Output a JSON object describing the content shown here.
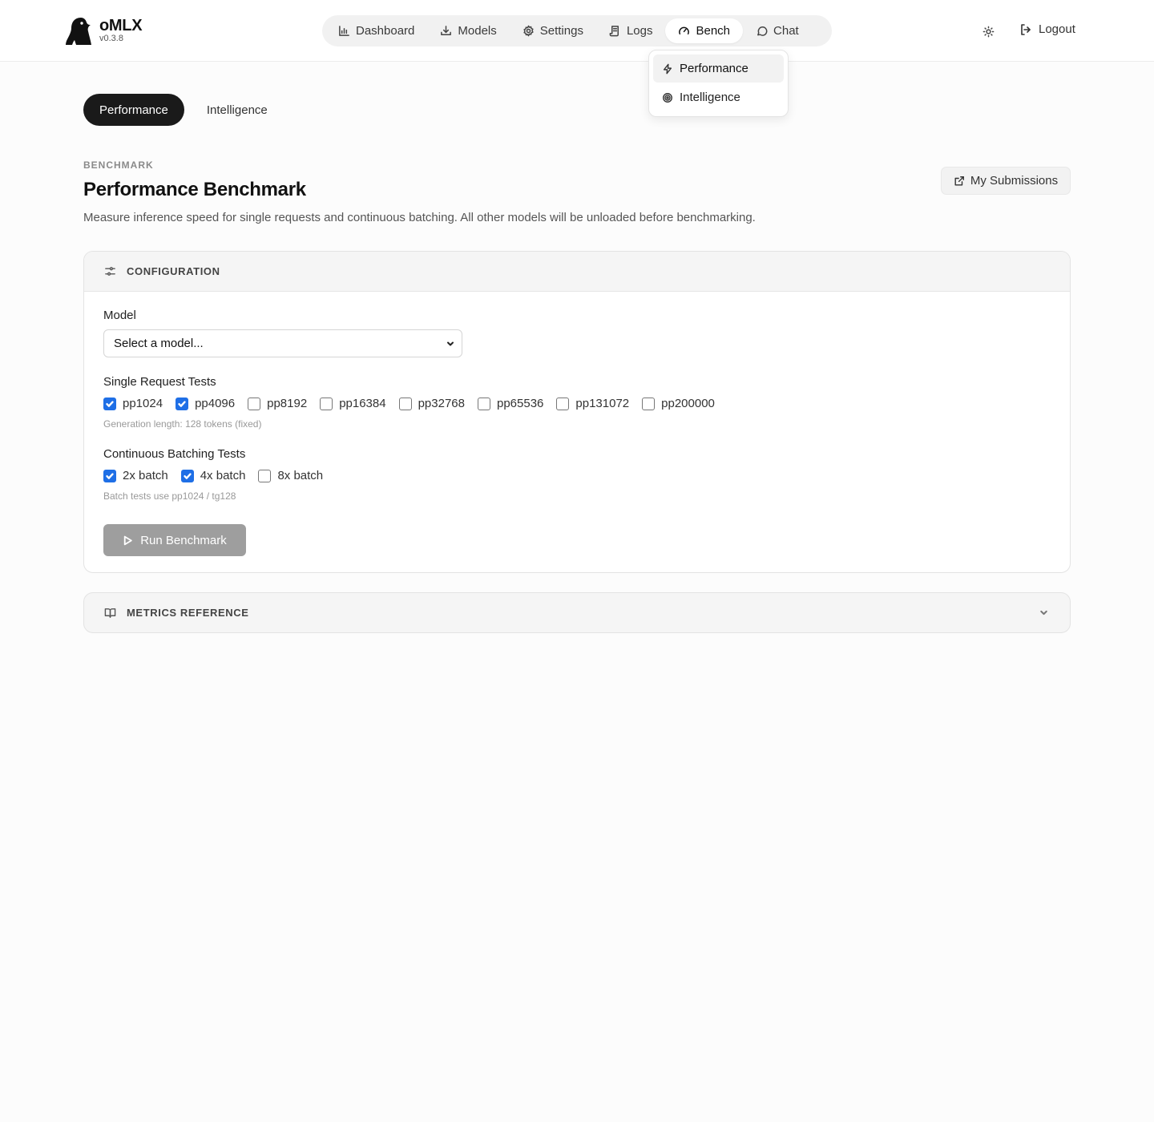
{
  "brand": {
    "name": "oMLX",
    "version": "v0.3.8"
  },
  "nav": {
    "items": [
      {
        "label": "Dashboard",
        "icon": "bar-chart-icon"
      },
      {
        "label": "Models",
        "icon": "download-icon"
      },
      {
        "label": "Settings",
        "icon": "gear-icon"
      },
      {
        "label": "Logs",
        "icon": "scroll-icon"
      },
      {
        "label": "Bench",
        "icon": "gauge-icon",
        "active": true
      },
      {
        "label": "Chat",
        "icon": "chat-bubble-icon"
      }
    ]
  },
  "header_actions": {
    "theme_icon": "sun-icon",
    "logout_label": "Logout"
  },
  "bench_menu": {
    "items": [
      {
        "label": "Performance",
        "icon": "lightning-icon",
        "active": true
      },
      {
        "label": "Intelligence",
        "icon": "target-icon"
      }
    ]
  },
  "subtabs": {
    "performance": "Performance",
    "intelligence": "Intelligence"
  },
  "page": {
    "eyebrow": "BENCHMARK",
    "title": "Performance Benchmark",
    "description": "Measure inference speed for single requests and continuous batching. All other models will be unloaded before benchmarking.",
    "submissions_label": "My Submissions"
  },
  "config": {
    "title": "CONFIGURATION",
    "model_label": "Model",
    "model_value": "Select a model...",
    "single_label": "Single Request Tests",
    "single_tests": [
      {
        "label": "pp1024",
        "checked": true
      },
      {
        "label": "pp4096",
        "checked": true
      },
      {
        "label": "pp8192",
        "checked": false
      },
      {
        "label": "pp16384",
        "checked": false
      },
      {
        "label": "pp32768",
        "checked": false
      },
      {
        "label": "pp65536",
        "checked": false
      },
      {
        "label": "pp131072",
        "checked": false
      },
      {
        "label": "pp200000",
        "checked": false
      }
    ],
    "single_hint": "Generation length: 128 tokens (fixed)",
    "batch_label": "Continuous Batching Tests",
    "batch_tests": [
      {
        "label": "2x batch",
        "checked": true
      },
      {
        "label": "4x batch",
        "checked": true
      },
      {
        "label": "8x batch",
        "checked": false
      }
    ],
    "batch_hint": "Batch tests use pp1024 / tg128",
    "run_label": "Run Benchmark"
  },
  "metrics": {
    "title": "METRICS REFERENCE"
  },
  "colors": {
    "accent": "#1f6fe6",
    "active_tab": "#1a1a1a",
    "disabled_button": "#9e9e9e"
  }
}
